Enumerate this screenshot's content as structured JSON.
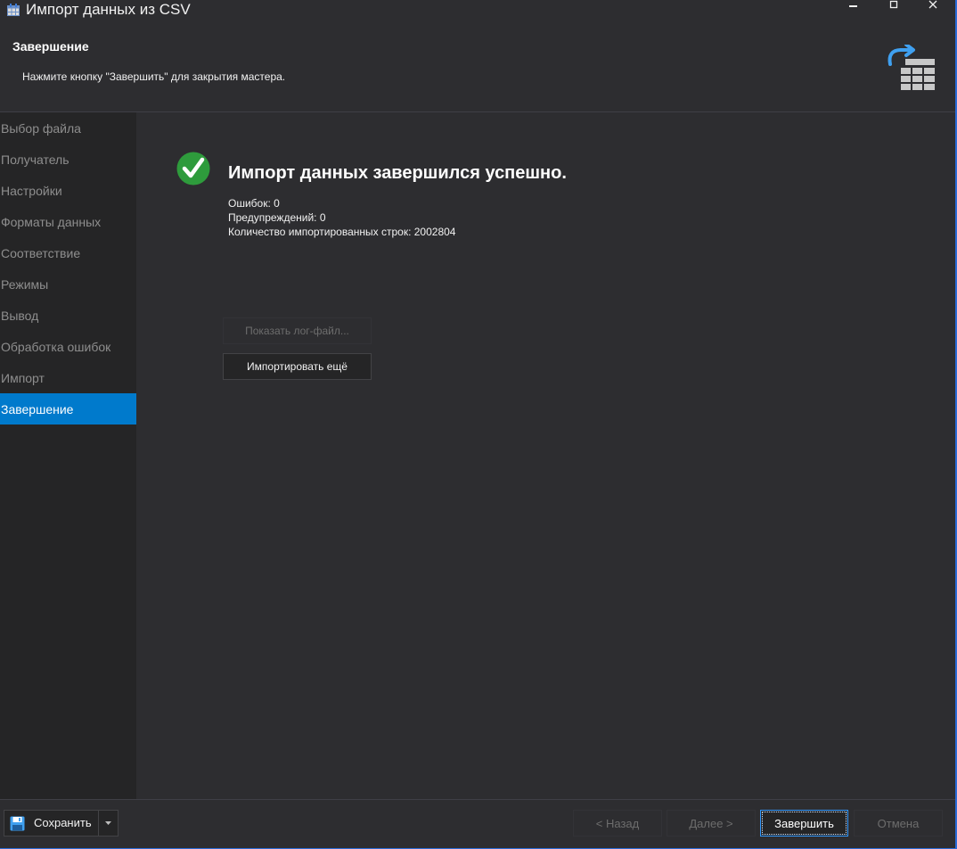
{
  "window": {
    "title": "Импорт данных из CSV",
    "minimize_glyph": "▬",
    "maximize_glyph": "☐",
    "close_glyph": "✕"
  },
  "header": {
    "title": "Завершение",
    "subtitle": "Нажмите кнопку \"Завершить\" для закрытия мастера.",
    "icon": "import-table-icon"
  },
  "sidebar": {
    "items": [
      {
        "label": "Выбор файла",
        "active": false
      },
      {
        "label": "Получатель",
        "active": false
      },
      {
        "label": "Настройки",
        "active": false
      },
      {
        "label": "Форматы данных",
        "active": false
      },
      {
        "label": "Соответствие",
        "active": false
      },
      {
        "label": "Режимы",
        "active": false
      },
      {
        "label": "Вывод",
        "active": false
      },
      {
        "label": "Обработка ошибок",
        "active": false
      },
      {
        "label": "Импорт",
        "active": false
      },
      {
        "label": "Завершение",
        "active": true
      }
    ]
  },
  "main": {
    "result_title": "Импорт данных завершился успешно.",
    "status_icon": "success-check-icon",
    "stats": {
      "errors": "Ошибок: 0",
      "warnings": "Предупреждений: 0",
      "rows": "Количество импортированных строк: 2002804"
    },
    "show_log_label": "Показать лог-файл...",
    "import_again_label": "Импортировать ещё"
  },
  "footer": {
    "save_label": "Сохранить",
    "back_label": "< Назад",
    "next_label": "Далее >",
    "finish_label": "Завершить",
    "cancel_label": "Отмена"
  },
  "colors": {
    "accent": "#007acc",
    "success": "#2e9b3c",
    "background": "#2d2d30",
    "sidebar": "#252526"
  }
}
